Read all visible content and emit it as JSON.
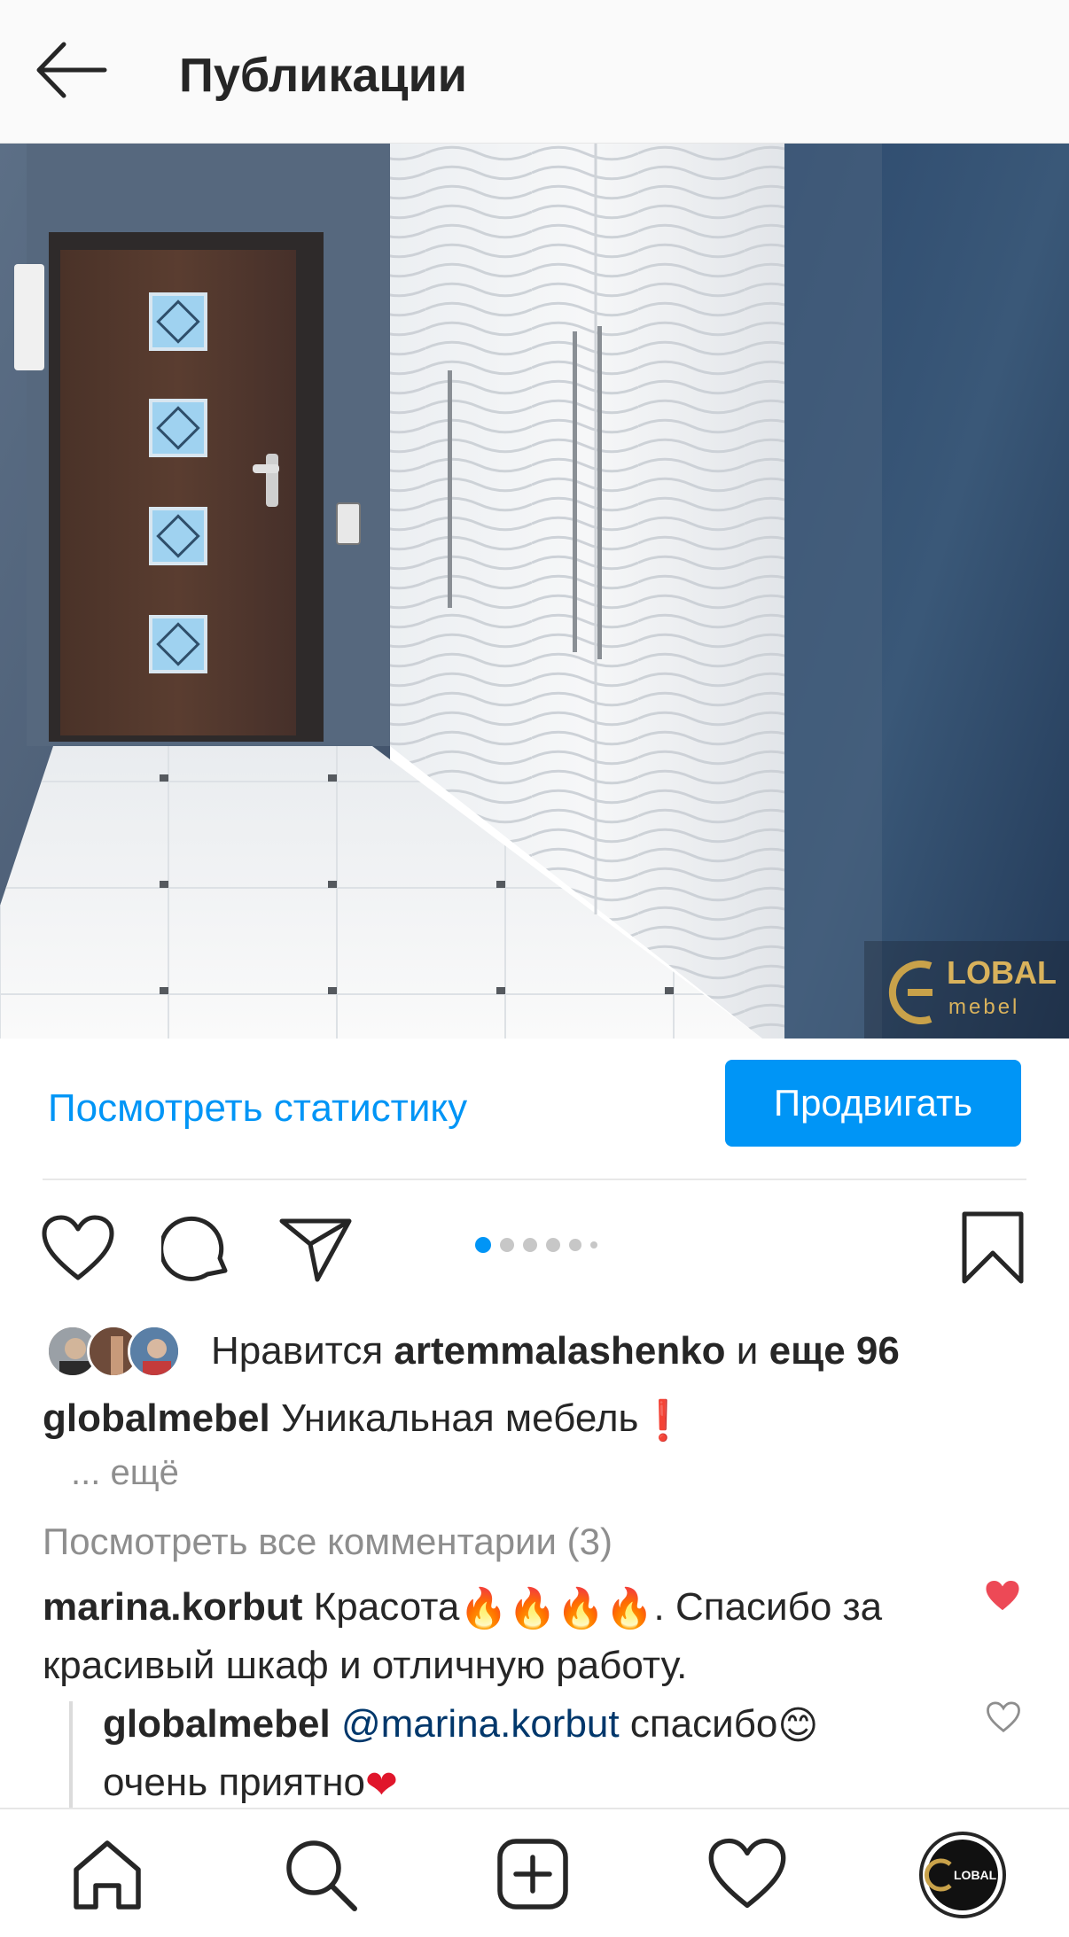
{
  "header": {
    "title": "Публикации",
    "back_icon": "arrow-left-icon"
  },
  "post": {
    "image_watermark": {
      "brand_line1": "LOBAL",
      "brand_line2": "mebel"
    },
    "stats_link": "Посмотреть статистику",
    "promote_label": "Продвигать",
    "carousel": {
      "count": 6,
      "active_index": 0,
      "accent": "#0095f6"
    },
    "likes": {
      "prefix": "Нравится",
      "user": "artemmalashenko",
      "middle": "и",
      "others": "еще 96"
    },
    "caption": {
      "user": "globalmebel",
      "text": "Уникальная мебель",
      "emoji": "❗",
      "more": "... ещё"
    },
    "view_all_comments": "Посмотреть все комментарии (3)",
    "comments": [
      {
        "user": "marina.korbut",
        "text_before": "Красота",
        "emoji": "🔥",
        "emoji_count": 4,
        "text_after": ". Спасибо за красивый шкаф и отличную работу.",
        "liked": true
      },
      {
        "user": "globalmebel",
        "mention": "@marina.korbut",
        "text": "спасибо",
        "emoji": "😊",
        "line2": "очень приятно",
        "emoji2": "❤",
        "liked": false
      }
    ]
  },
  "bottom_nav": {
    "items": [
      "home-icon",
      "search-icon",
      "new-post-icon",
      "activity-heart-icon",
      "profile-avatar"
    ],
    "profile_avatar_text": "LOBAL"
  },
  "colors": {
    "accent": "#0095f6",
    "like_red": "#ed4956",
    "text": "#262626",
    "secondary": "#8e8e8e"
  }
}
